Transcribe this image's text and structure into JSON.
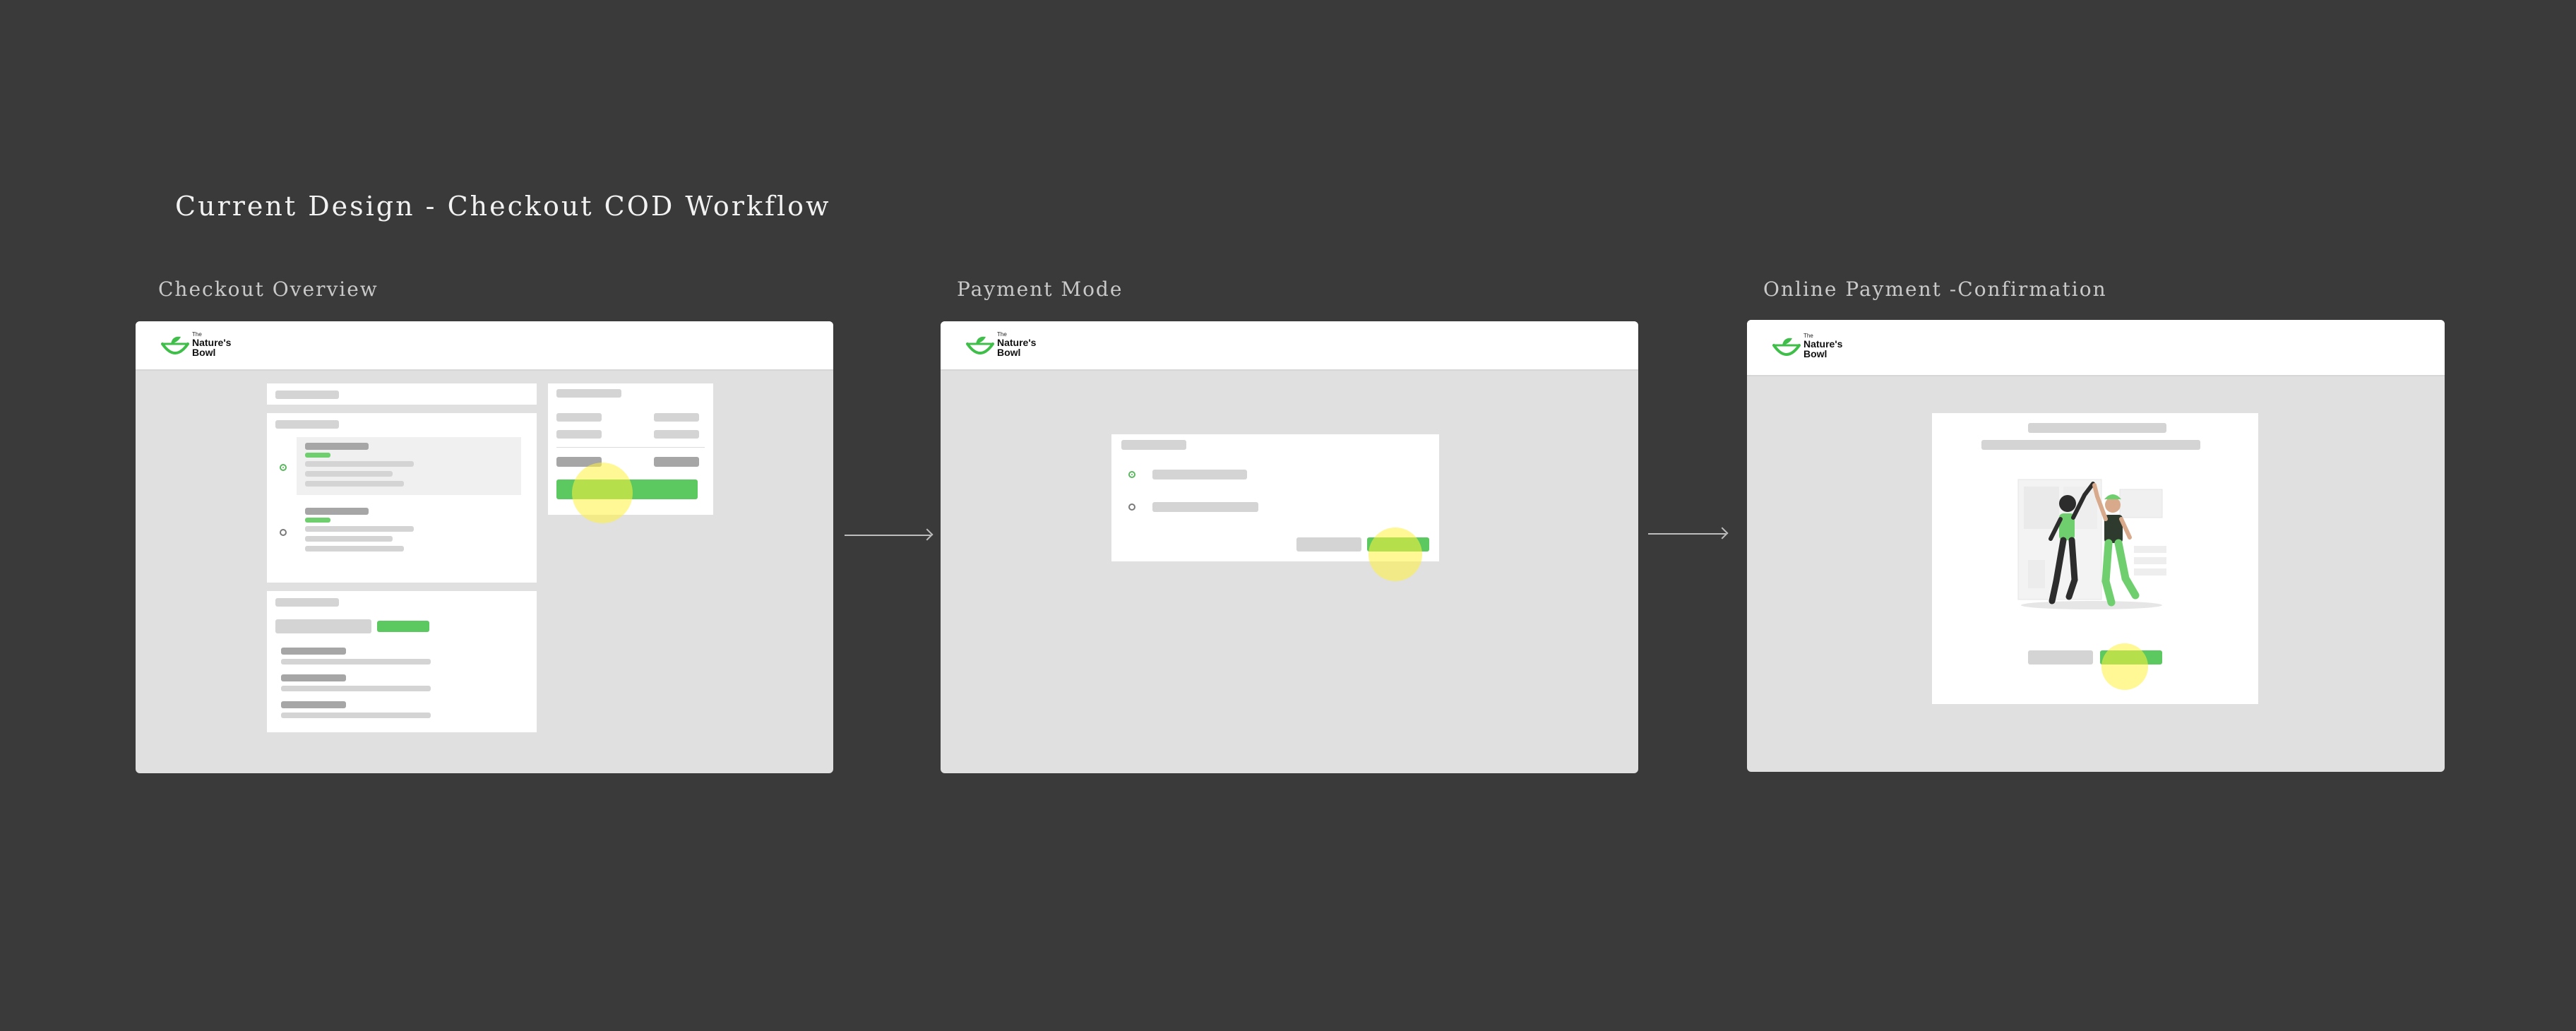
{
  "title": "Current Design - Checkout COD Workflow",
  "frames": [
    {
      "label": "Checkout Overview"
    },
    {
      "label": "Payment Mode"
    },
    {
      "label": "Online Payment -Confirmation"
    }
  ],
  "logo": {
    "the": "The",
    "name": "Nature's Bowl"
  },
  "colors": {
    "background": "#3a3a3a",
    "frame_bg": "#e0e0e0",
    "accent_green": "#5bc95f",
    "tap_highlight": "#fff23c"
  },
  "icons": [
    "bowl-logo-icon",
    "flow-arrow-icon",
    "tap-indicator",
    "radio-icon",
    "celebration-illustration"
  ]
}
